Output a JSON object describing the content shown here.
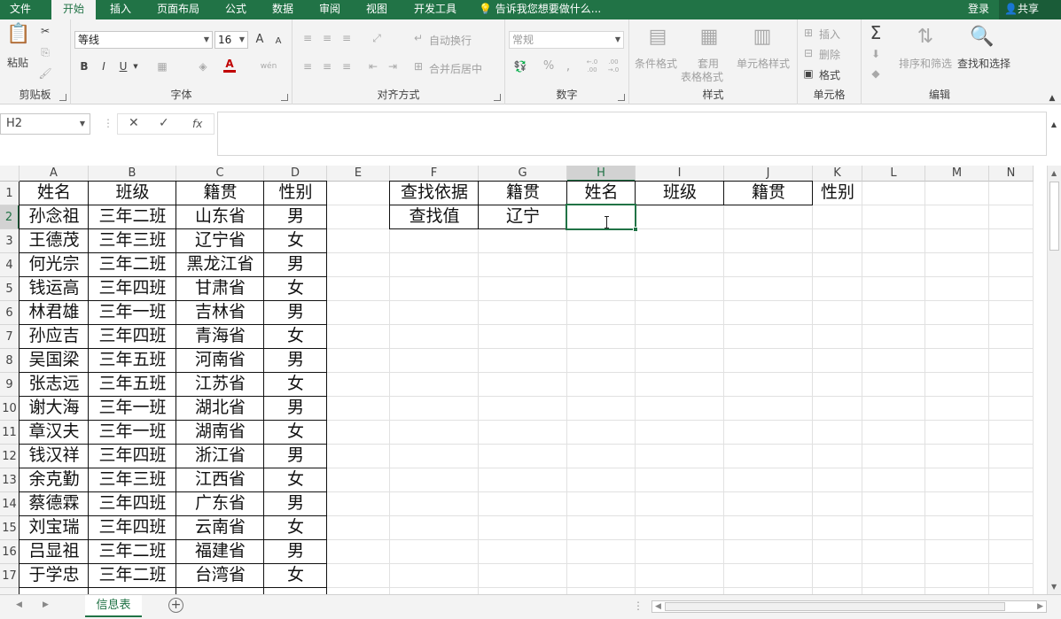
{
  "ribbon_tabs": [
    "文件",
    "开始",
    "插入",
    "页面布局",
    "公式",
    "数据",
    "审阅",
    "视图",
    "开发工具"
  ],
  "tell_me": "告诉我您想要做什么...",
  "account": {
    "login": "登录",
    "share": "共享"
  },
  "clipboard": {
    "paste": "粘贴",
    "group": "剪贴板"
  },
  "font": {
    "name": "等线",
    "size": "16",
    "grow": "A",
    "shrink": "A",
    "bold": "B",
    "italic": "I",
    "underline": "U",
    "color_letter": "A",
    "phonetic": "wén",
    "group": "字体"
  },
  "alignment": {
    "wrap": "自动换行",
    "merge": "合并后居中",
    "group": "对齐方式"
  },
  "number": {
    "format": "常规",
    "percent": "%",
    "comma": ",",
    "group": "数字",
    "inc_decimal": "←.0 .00",
    "dec_decimal": ".00 →.0"
  },
  "styles": {
    "conditional": "条件格式",
    "table_l1": "套用",
    "table_l2": "表格格式",
    "cell_styles": "单元格样式",
    "group": "样式"
  },
  "cells": {
    "insert": "插入",
    "delete": "删除",
    "format": "格式",
    "group": "单元格"
  },
  "editing": {
    "sigma": "Σ",
    "sort": "排序和筛选",
    "find": "查找和选择",
    "group": "编辑"
  },
  "formula_bar": {
    "name_box": "H2",
    "fx": "fx",
    "value": ""
  },
  "columns": [
    "A",
    "B",
    "C",
    "D",
    "E",
    "F",
    "G",
    "H",
    "I",
    "J",
    "K",
    "L",
    "M",
    "N"
  ],
  "selected_column": "H",
  "selected_row": "2",
  "rows": [
    {
      "num": "1",
      "a": "姓名",
      "b": "班级",
      "c": "籍贯",
      "d": "性别",
      "f": "查找依据",
      "g": "籍贯",
      "h": "姓名",
      "i": "班级",
      "j": "籍贯",
      "k": "性别"
    },
    {
      "num": "2",
      "a": "孙念祖",
      "b": "三年二班",
      "c": "山东省",
      "d": "男",
      "f": "查找值",
      "g": "辽宁",
      "h": "",
      "i": "",
      "j": "",
      "k": ""
    },
    {
      "num": "3",
      "a": "王德茂",
      "b": "三年三班",
      "c": "辽宁省",
      "d": "女"
    },
    {
      "num": "4",
      "a": "何光宗",
      "b": "三年二班",
      "c": "黑龙江省",
      "d": "男"
    },
    {
      "num": "5",
      "a": "钱运高",
      "b": "三年四班",
      "c": "甘肃省",
      "d": "女"
    },
    {
      "num": "6",
      "a": "林君雄",
      "b": "三年一班",
      "c": "吉林省",
      "d": "男"
    },
    {
      "num": "7",
      "a": "孙应吉",
      "b": "三年四班",
      "c": "青海省",
      "d": "女"
    },
    {
      "num": "8",
      "a": "吴国梁",
      "b": "三年五班",
      "c": "河南省",
      "d": "男"
    },
    {
      "num": "9",
      "a": "张志远",
      "b": "三年五班",
      "c": "江苏省",
      "d": "女"
    },
    {
      "num": "10",
      "a": "谢大海",
      "b": "三年一班",
      "c": "湖北省",
      "d": "男"
    },
    {
      "num": "11",
      "a": "章汉夫",
      "b": "三年一班",
      "c": "湖南省",
      "d": "女"
    },
    {
      "num": "12",
      "a": "钱汉祥",
      "b": "三年四班",
      "c": "浙江省",
      "d": "男"
    },
    {
      "num": "13",
      "a": "余克勤",
      "b": "三年三班",
      "c": "江西省",
      "d": "女"
    },
    {
      "num": "14",
      "a": "蔡德霖",
      "b": "三年四班",
      "c": "广东省",
      "d": "男"
    },
    {
      "num": "15",
      "a": "刘宝瑞",
      "b": "三年四班",
      "c": "云南省",
      "d": "女"
    },
    {
      "num": "16",
      "a": "吕显祖",
      "b": "三年二班",
      "c": "福建省",
      "d": "男"
    },
    {
      "num": "17",
      "a": "于学忠",
      "b": "三年二班",
      "c": "台湾省",
      "d": "女"
    }
  ],
  "sheet_tab": "信息表",
  "add_sheet": "+",
  "colors": {
    "accent": "#217346"
  }
}
